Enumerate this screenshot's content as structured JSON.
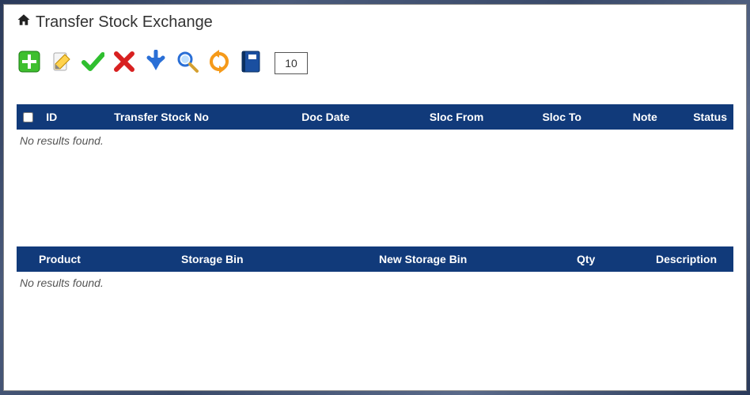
{
  "header": {
    "title": "Transfer Stock Exchange"
  },
  "toolbar": {
    "page_value": "10",
    "icons": {
      "add": "add-icon",
      "edit": "edit-icon",
      "approve": "check-icon",
      "delete": "x-icon",
      "download": "download-arrow-icon",
      "search": "search-icon",
      "refresh": "refresh-icon",
      "book": "book-icon"
    }
  },
  "table1": {
    "columns": {
      "id": "ID",
      "transfer_stock_no": "Transfer Stock No",
      "doc_date": "Doc Date",
      "sloc_from": "Sloc From",
      "sloc_to": "Sloc To",
      "note": "Note",
      "status": "Status"
    },
    "empty_message": "No results found."
  },
  "table2": {
    "columns": {
      "product": "Product",
      "storage_bin": "Storage Bin",
      "new_storage_bin": "New Storage Bin",
      "qty": "Qty",
      "description": "Description"
    },
    "empty_message": "No results found."
  }
}
